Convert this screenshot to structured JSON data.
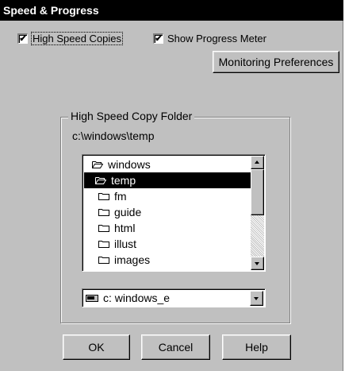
{
  "dialog": {
    "title": "Speed & Progress"
  },
  "options": {
    "high_speed": {
      "label": "High Speed Copies",
      "checked_mark": "✔"
    },
    "progress": {
      "label": "Show Progress Meter",
      "checked_mark": "✔"
    },
    "monitoring_button": "Monitoring Preferences"
  },
  "folder_group": {
    "title": "High Speed Copy Folder",
    "path": "c:\\windows\\temp",
    "folders": [
      {
        "label": "windows",
        "icon": "folder-open-icon",
        "selected": false
      },
      {
        "label": "temp",
        "icon": "folder-open-icon",
        "selected": true
      },
      {
        "label": "fm",
        "icon": "folder-closed-icon",
        "selected": false
      },
      {
        "label": "guide",
        "icon": "folder-closed-icon",
        "selected": false
      },
      {
        "label": "html",
        "icon": "folder-closed-icon",
        "selected": false
      },
      {
        "label": "illust",
        "icon": "folder-closed-icon",
        "selected": false
      },
      {
        "label": "images",
        "icon": "folder-closed-icon",
        "selected": false
      }
    ],
    "drive": {
      "label": "c: windows_e",
      "icon": "drive-icon"
    }
  },
  "buttons": {
    "ok": "OK",
    "cancel": "Cancel",
    "help": "Help"
  },
  "colors": {
    "face": "#c0c0c0",
    "title_bg": "#000000",
    "selection": "#000000"
  }
}
